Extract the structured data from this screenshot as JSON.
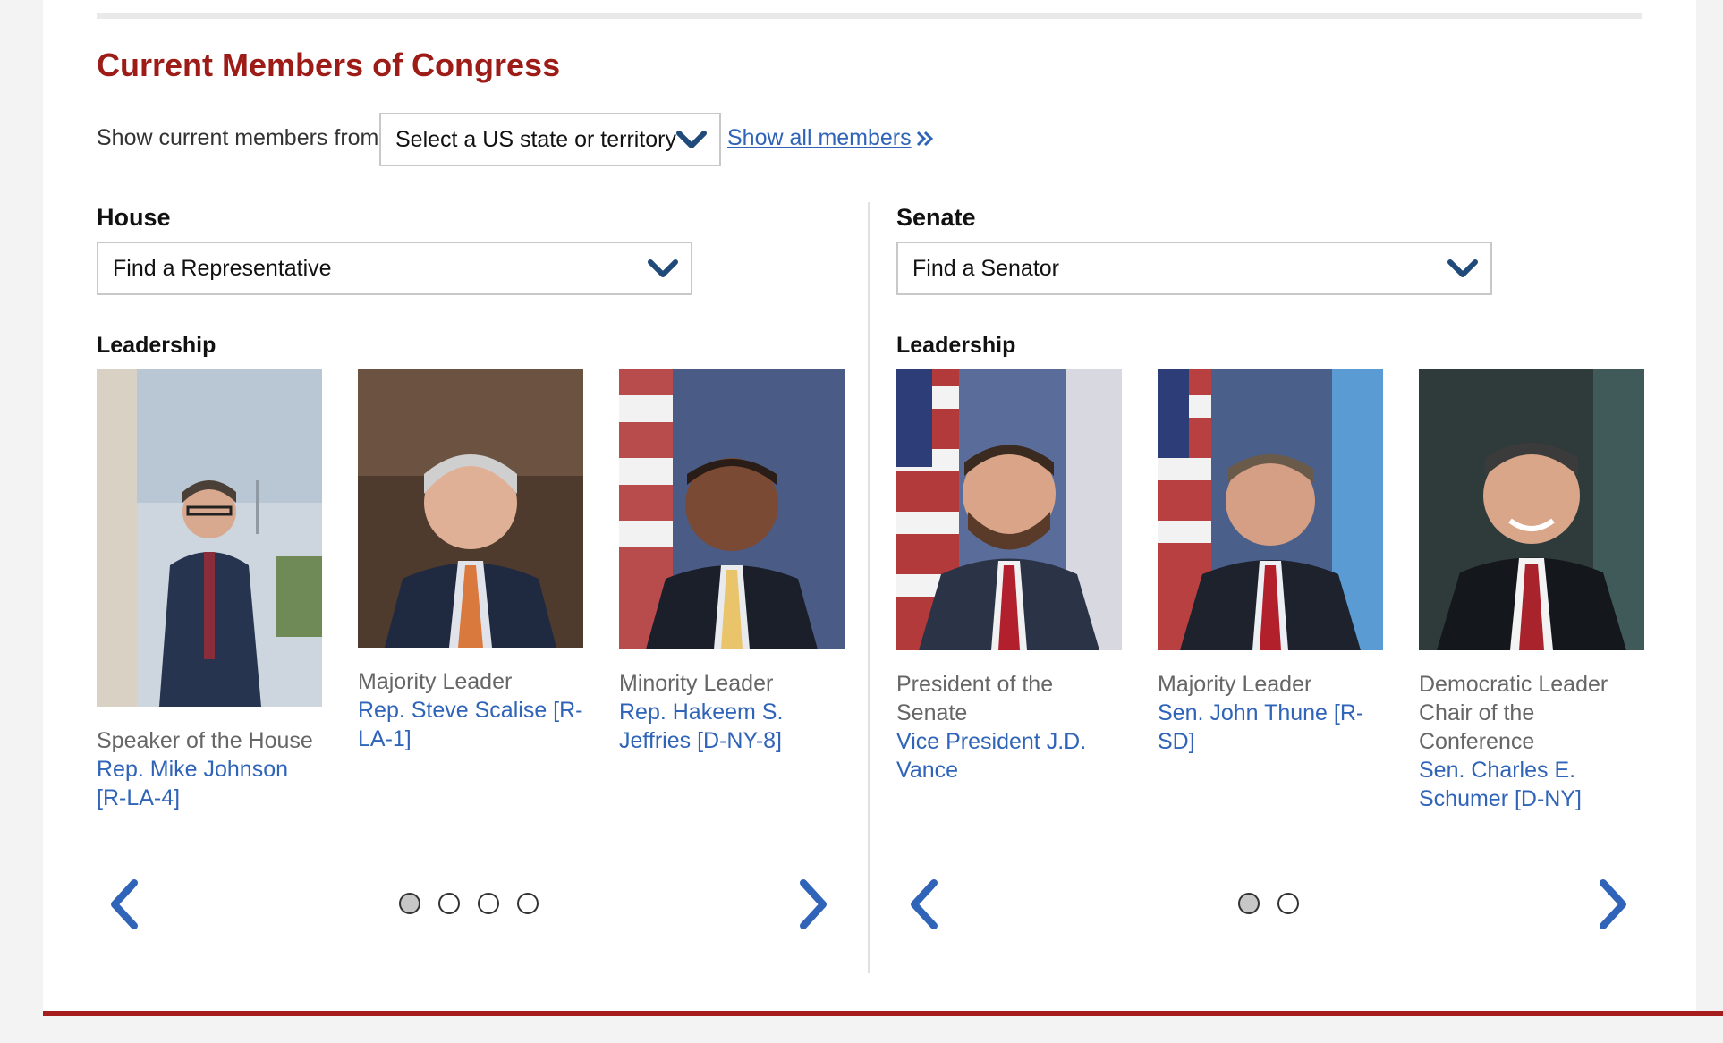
{
  "page_title": "Current Members of Congress",
  "filter": {
    "label": "Show current members from:",
    "state_select": "Select a US state or territory",
    "show_all": "Show all members"
  },
  "house": {
    "title": "House",
    "select": "Find a Representative",
    "leadership_label": "Leadership",
    "members": [
      {
        "role": "Speaker of the House",
        "name": "Rep. Mike Johnson [R-LA-4]"
      },
      {
        "role": "Majority Leader",
        "name": "Rep. Steve Scalise [R-LA-1]"
      },
      {
        "role": "Minority Leader",
        "name": "Rep. Hakeem S. Jeffries [D-NY-8]"
      }
    ],
    "pages": 4,
    "current_page": 1
  },
  "senate": {
    "title": "Senate",
    "select": "Find a Senator",
    "leadership_label": "Leadership",
    "members": [
      {
        "role": "President of the Senate",
        "name": "Vice President J.D. Vance"
      },
      {
        "role": "Majority Leader",
        "name": "Sen. John Thune [R-SD]"
      },
      {
        "role": "Democratic Leader Chair of the Conference",
        "name": "Sen. Charles E. Schumer [D-NY]"
      }
    ],
    "pages": 2,
    "current_page": 1
  },
  "colors": {
    "title_red": "#9d1c17",
    "link_blue": "#2f64b8",
    "chevron_navy": "#1f4a7a",
    "rule_red": "#a51d1d"
  },
  "icons": {
    "select_chevron": "chevron-down-icon",
    "show_all": "double-chevron-right-icon",
    "prev": "chevron-left-icon",
    "next": "chevron-right-icon"
  }
}
